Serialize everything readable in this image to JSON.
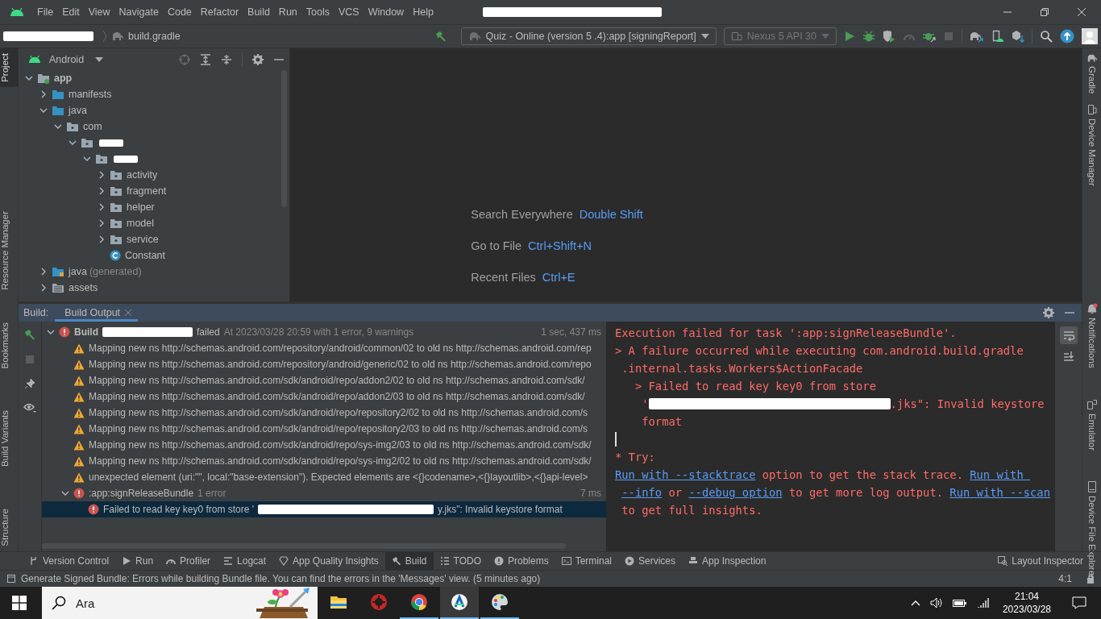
{
  "menu": {
    "items": [
      "File",
      "Edit",
      "View",
      "Navigate",
      "Code",
      "Refactor",
      "Build",
      "Run",
      "Tools",
      "VCS",
      "Window",
      "Help"
    ],
    "title_redacted": true
  },
  "navbar": {
    "project_redacted": true,
    "file": "build.gradle",
    "run_config": "Quiz - Online (version 5 .4):app [signingReport]",
    "device": "Nexus 5 API 30"
  },
  "left_stripe": {
    "top": [
      {
        "label": "Project",
        "selected": true
      },
      {
        "label": "Resource Manager",
        "selected": false
      }
    ],
    "bottom": [
      {
        "label": "Bookmarks",
        "selected": false
      },
      {
        "label": "Build Variants",
        "selected": false
      },
      {
        "label": "Structure",
        "selected": false
      }
    ]
  },
  "right_stripe": {
    "top": [
      {
        "label": "Gradle"
      },
      {
        "label": "Device Manager"
      }
    ],
    "bottom": [
      {
        "label": "Notifications",
        "badge": true
      },
      {
        "label": "Emulator"
      },
      {
        "label": "Device File Explorer"
      }
    ]
  },
  "project": {
    "view": "Android",
    "tree": [
      {
        "kind": "module",
        "label": "app",
        "expanded": true,
        "children": [
          {
            "kind": "folder",
            "label": "manifests",
            "expanded": false
          },
          {
            "kind": "folder",
            "label": "java",
            "expanded": true,
            "children": [
              {
                "kind": "package",
                "label": "com",
                "expanded": true,
                "children": [
                  {
                    "kind": "package",
                    "redacted": true,
                    "expanded": true,
                    "children": [
                      {
                        "kind": "package",
                        "redacted": true,
                        "expanded": true,
                        "children": [
                          {
                            "kind": "package",
                            "label": "activity",
                            "expanded": false
                          },
                          {
                            "kind": "package",
                            "label": "fragment",
                            "expanded": false
                          },
                          {
                            "kind": "package",
                            "label": "helper",
                            "expanded": false
                          },
                          {
                            "kind": "package",
                            "label": "model",
                            "expanded": false
                          },
                          {
                            "kind": "package",
                            "label": "service",
                            "expanded": false
                          },
                          {
                            "kind": "class",
                            "label": "Constant"
                          }
                        ]
                      }
                    ]
                  }
                ]
              }
            ]
          },
          {
            "kind": "generated",
            "label": "java",
            "note": "(generated)",
            "expanded": false
          },
          {
            "kind": "assets",
            "label": "assets",
            "expanded": false
          }
        ]
      }
    ]
  },
  "editor": {
    "hints": [
      {
        "action": "Search Everywhere",
        "shortcut": "Double Shift"
      },
      {
        "action": "Go to File",
        "shortcut": "Ctrl+Shift+N"
      },
      {
        "action": "Recent Files",
        "shortcut": "Ctrl+E"
      }
    ]
  },
  "build": {
    "label": "Build:",
    "tabs": [
      {
        "label": "Build Output",
        "selected": true
      }
    ],
    "tree": [
      {
        "kind": "error",
        "label": "Build",
        "redacted": true,
        "label_after": "failed",
        "detail": "At 2023/03/28 20:59 with 1 error, 9 warnings",
        "time": "1 sec, 437 ms",
        "expanded": true,
        "selected": false,
        "children": [
          {
            "kind": "warning",
            "label": "Mapping new ns http://schemas.android.com/repository/android/common/02 to old ns http://schemas.android.com/rep",
            "selected": false
          },
          {
            "kind": "warning",
            "label": "Mapping new ns http://schemas.android.com/repository/android/generic/02 to old ns http://schemas.android.com/repo",
            "selected": false
          },
          {
            "kind": "warning",
            "label": "Mapping new ns http://schemas.android.com/sdk/android/repo/addon2/02 to old ns http://schemas.android.com/sdk/",
            "selected": false
          },
          {
            "kind": "warning",
            "label": "Mapping new ns http://schemas.android.com/sdk/android/repo/addon2/03 to old ns http://schemas.android.com/sdk/",
            "selected": false
          },
          {
            "kind": "warning",
            "label": "Mapping new ns http://schemas.android.com/sdk/android/repo/repository2/02 to old ns http://schemas.android.com/s",
            "selected": false
          },
          {
            "kind": "warning",
            "label": "Mapping new ns http://schemas.android.com/sdk/android/repo/repository2/03 to old ns http://schemas.android.com/s",
            "selected": false
          },
          {
            "kind": "warning",
            "label": "Mapping new ns http://schemas.android.com/sdk/android/repo/sys-img2/03 to old ns http://schemas.android.com/sdk/",
            "selected": false
          },
          {
            "kind": "warning",
            "label": "Mapping new ns http://schemas.android.com/sdk/android/repo/sys-img2/02 to old ns http://schemas.android.com/sdk/",
            "selected": false
          },
          {
            "kind": "warning",
            "label": "unexpected element (uri:\"\", local:\"base-extension\"). Expected elements are <{}codename>,<{}layoutlib>,<{}api-level>",
            "selected": false
          },
          {
            "kind": "error",
            "label": ":app:signReleaseBundle",
            "detail": "1 error",
            "time": "7 ms",
            "expanded": true,
            "selected": false,
            "children": [
              {
                "kind": "error",
                "label": "Failed to read key key0 from store '",
                "redacted": true,
                "label_after": "y.jks\": Invalid keystore format",
                "selected": true
              }
            ]
          }
        ]
      }
    ],
    "console": [
      {
        "segments": [
          {
            "kind": "text",
            "text": "Execution failed for task ':app:signReleaseBundle'."
          }
        ]
      },
      {
        "segments": [
          {
            "kind": "text",
            "text": "> A failure occurred while executing com.android.build.gradle"
          }
        ]
      },
      {
        "segments": [
          {
            "kind": "text",
            "text": " .internal.tasks.Workers$ActionFacade"
          }
        ]
      },
      {
        "segments": [
          {
            "kind": "text",
            "text": "   > Failed to read key key0 from store"
          }
        ]
      },
      {
        "segments": [
          {
            "kind": "text",
            "text": "    '"
          },
          {
            "kind": "redaction"
          },
          {
            "kind": "text",
            "text": ".jks\": Invalid keystore"
          }
        ]
      },
      {
        "segments": [
          {
            "kind": "text",
            "text": "    format"
          }
        ]
      },
      {
        "segments": [
          {
            "kind": "cursor"
          }
        ]
      },
      {
        "segments": [
          {
            "kind": "text",
            "text": "* Try:"
          }
        ]
      },
      {
        "segments": [
          {
            "kind": "link",
            "text": "Run with --stacktrace"
          },
          {
            "kind": "text",
            "text": " option to get the stack trace. "
          },
          {
            "kind": "link",
            "text": "Run with "
          }
        ]
      },
      {
        "continued": true,
        "segments": [
          {
            "kind": "link",
            "text": "--info"
          },
          {
            "kind": "text",
            "text": " or "
          },
          {
            "kind": "link",
            "text": "--debug option"
          },
          {
            "kind": "text",
            "text": " to get more log output. "
          },
          {
            "kind": "link",
            "text": "Run with --scan"
          }
        ]
      },
      {
        "segments": [
          {
            "kind": "text",
            "text": " to get full insights."
          }
        ]
      }
    ],
    "console_tools": [
      {
        "selected": true
      },
      {
        "selected": false
      }
    ]
  },
  "toolwindows": {
    "left": [
      {
        "label": "Version Control",
        "selected": false
      },
      {
        "label": "Run",
        "selected": false
      },
      {
        "label": "Profiler",
        "selected": false
      },
      {
        "label": "Logcat",
        "selected": false
      },
      {
        "label": "App Quality Insights",
        "selected": false
      },
      {
        "label": "Build",
        "selected": true
      },
      {
        "label": "TODO",
        "selected": false
      },
      {
        "label": "Problems",
        "selected": false
      },
      {
        "label": "Terminal",
        "selected": false
      },
      {
        "label": "Services",
        "selected": false
      },
      {
        "label": "App Inspection",
        "selected": false
      }
    ],
    "right": [
      {
        "label": "Layout Inspector",
        "selected": false
      }
    ]
  },
  "status_bar": {
    "message": "Generate Signed Bundle: Errors while building Bundle file. You can find the errors in the 'Messages' view. (5 minutes ago)",
    "position": "4:1"
  },
  "taskbar": {
    "search_placeholder": "Ara",
    "apps": [
      {
        "running": false,
        "selected": false
      },
      {
        "running": false,
        "selected": false
      },
      {
        "running": true,
        "selected": false
      },
      {
        "running": true,
        "selected": true
      },
      {
        "running": true,
        "selected": false
      }
    ],
    "time": "21:04",
    "date": "2023/03/28"
  }
}
